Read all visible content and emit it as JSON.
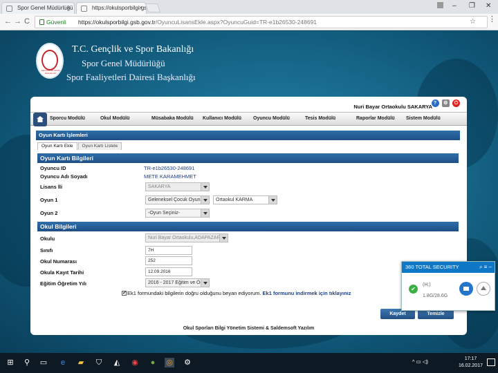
{
  "browser": {
    "tabs": [
      {
        "title": "Spor Genel Müdürlüğü"
      },
      {
        "title": "https://okulsporbilgi.gs"
      }
    ],
    "nav": {
      "back": "←",
      "forward": "→",
      "reload": "C"
    },
    "secure_label": "Güvenli",
    "url_host": "https://okulsporbilgi.gsb.gov.tr",
    "url_path": "/OyuncuLisansEkle.aspx?OyuncuGuid=TR-e1b26530-248691"
  },
  "header": {
    "line1": "T.C. Gençlik ve Spor Bakanlığı",
    "line2": "Spor Genel Müdürlüğü",
    "line3": "Spor Faaliyetleri Dairesi Başkanlığı",
    "logo_text": "GENÇLİK VE SPOR BAKANLIĞI"
  },
  "user": {
    "school": "Nuri Bayar Ortaokulu SAKARYA"
  },
  "menu": [
    "Sporcu Modülü",
    "Okul Modülü",
    "Müsabaka Modülü",
    "Kullanıcı Modülü",
    "Oyuncu Modülü",
    "Tesis Modülü",
    "Raporlar Modülü",
    "Sistem Modülü"
  ],
  "page": {
    "section_title": "Oyun Kartı İşlemleri",
    "subtabs": [
      "Oyun Kartı Ekle",
      "Oyun Kartı Listele"
    ],
    "card_section": "Oyun Kartı Bilgileri",
    "school_section": "Okul Bilgileri"
  },
  "card": {
    "player_id_label": "Oyuncu ID",
    "player_id": "TR-e1b26530-248691",
    "player_name_label": "Oyuncu Adı Soyadı",
    "player_name": "METE KARAMEHMET",
    "license_city_label": "Lisans İli",
    "license_city": "SAKARYA",
    "game1_label": "Oyun 1",
    "game1": "Geleneksel Çocuk Oyunla",
    "game1_cat": "Ortaokul KARMA",
    "game2_label": "Oyun 2",
    "game2": "-Oyun Seçiniz-"
  },
  "school": {
    "school_label": "Okulu",
    "school": "Nuri Bayar Ortaokulu,ADAPAZAR",
    "class_label": "Sınıfı",
    "class": "7H",
    "number_label": "Okul Numarası",
    "number": "252",
    "reg_date_label": "Okula Kayıt Tarihi",
    "reg_date": "12.09.2016",
    "year_label": "Eğitim Öğretim Yılı",
    "year": "2016 - 2017 Eğitim ve Öğ"
  },
  "declaration": {
    "text": "Ek1 formundaki bilgilerin doğru olduğunu beyan ediyorum.",
    "link": "Ek1 formunu indirmek için tıklayınız",
    "checked": "✔"
  },
  "buttons": {
    "save": "Kaydet",
    "clear": "Temizle"
  },
  "footer": "Okul Sporları Bilgi Yönetim Sistemi & Saldemsoft Yazılım",
  "popup": {
    "title": "360 TOTAL SECURITY",
    "drive": "(H:)",
    "size": "1.8G/28.6G",
    "check": "✔"
  },
  "taskbar": {
    "time": "17:17",
    "date": "16.02.2017"
  }
}
